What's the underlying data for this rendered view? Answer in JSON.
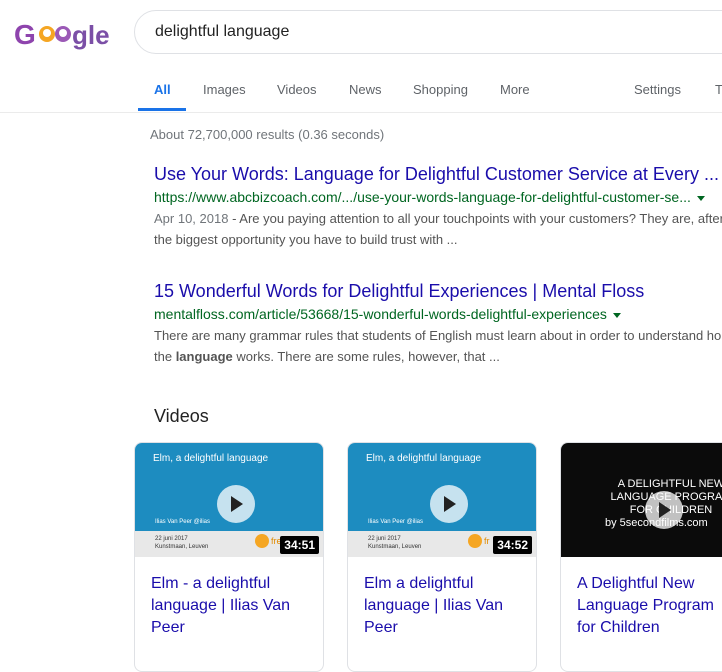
{
  "search": {
    "query": "delightful language"
  },
  "tabs": [
    {
      "label": "All"
    },
    {
      "label": "Images"
    },
    {
      "label": "Videos"
    },
    {
      "label": "News"
    },
    {
      "label": "Shopping"
    },
    {
      "label": "More"
    },
    {
      "label": "Settings"
    },
    {
      "label": "T"
    }
  ],
  "stats": "About 72,700,000 results (0.36 seconds)",
  "results": [
    {
      "title": "Use Your Words: Language for Delightful Customer Service at Every ...",
      "url": "https://www.abcbizcoach.com/.../use-your-words-language-for-delightful-customer-se...",
      "date": "Apr 10, 2018",
      "snippet1": " - Are you paying attention to all your touchpoints with your customers? They are, after",
      "snippet2": "the biggest opportunity you have to build trust with ..."
    },
    {
      "title": "15 Wonderful Words for Delightful Experiences | Mental Floss",
      "url": "mentalfloss.com/article/53668/15-wonderful-words-delightful-experiences",
      "snippet1": "There are many grammar rules that students of English must learn about in order to understand ho",
      "snippet2_pre": "the ",
      "snippet2_bold": "language",
      "snippet2_post": " works. There are some rules, however, that ..."
    }
  ],
  "videos": {
    "heading": "Videos",
    "items": [
      {
        "thumb_title": "Elm, a delightful language",
        "thumb_name": "Ilias Van Peer @ilias",
        "thumb_date": "22 juni 2017",
        "thumb_place": "Kunstmaan, Leuven",
        "thumb_brand": "fre",
        "duration": "34:51",
        "title": "Elm - a delightful language | Ilias Van Peer"
      },
      {
        "thumb_title": "Elm, a delightful language",
        "thumb_name": "Ilias Van Peer @ilias",
        "thumb_date": "22 juni 2017",
        "thumb_place": "Kunstmaan, Leuven",
        "thumb_brand": "fr",
        "duration": "34:52",
        "title": "Elm a delightful language | Ilias Van Peer"
      },
      {
        "thumb_text": "A DELIGHTFUL NEW LANGUAGE PROGRAM FOR CHILDREN",
        "thumb_by": "by 5secondfilms.com",
        "title": "A Delightful New Language Program for Children"
      }
    ]
  },
  "colors": {
    "link": "#1a0dab",
    "url": "#006621",
    "accent": "#1a73e8",
    "thumb_blue": "#1d8cc0"
  }
}
